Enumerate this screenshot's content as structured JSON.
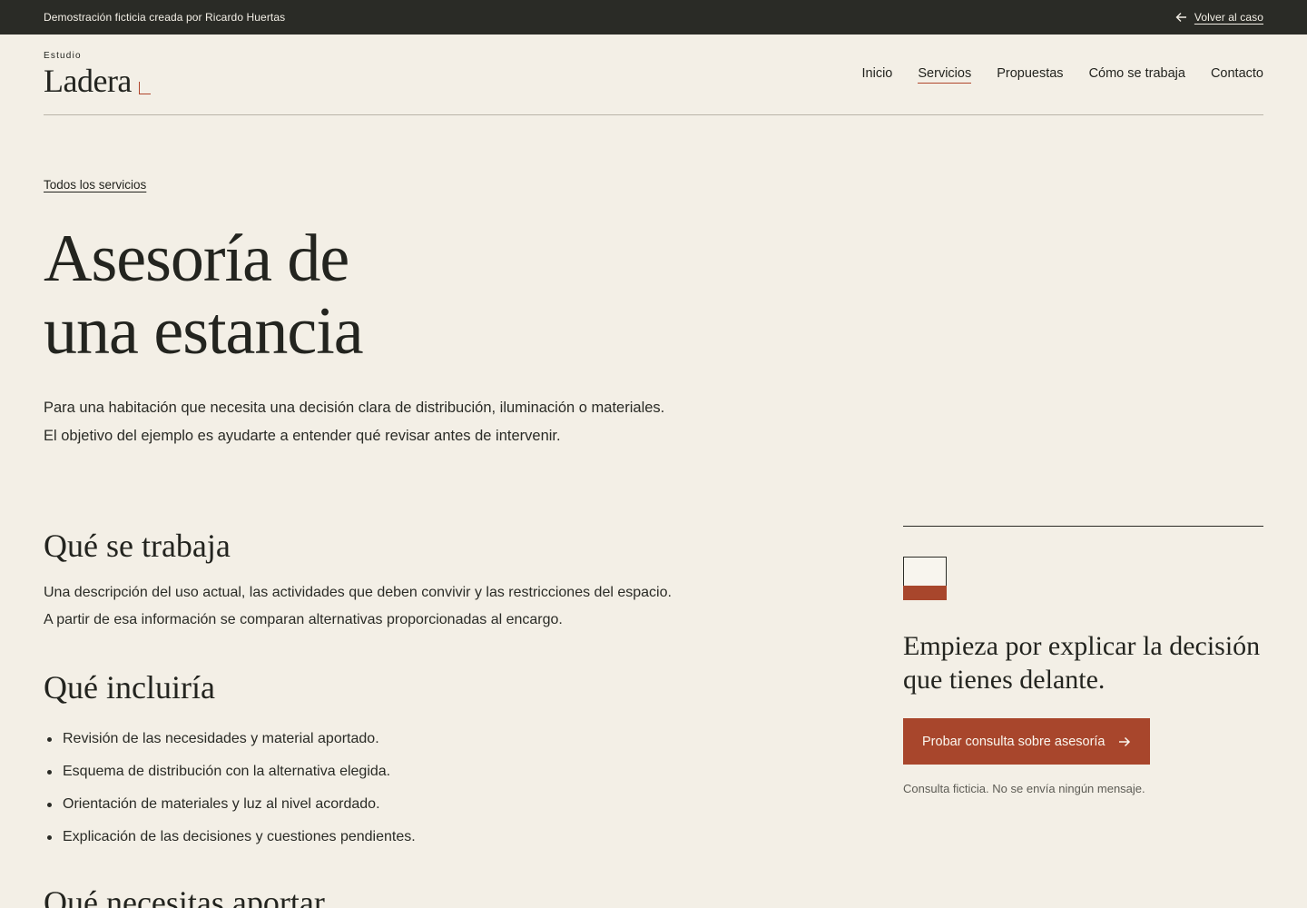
{
  "demo_bar": {
    "notice": "Demostración ficticia creada por Ricardo Huertas",
    "back_label": "Volver al caso",
    "back_icon": "arrow-left-icon"
  },
  "header": {
    "logo_small": "Estudio",
    "logo_big": "Ladera",
    "nav": [
      {
        "label": "Inicio"
      },
      {
        "label": "Servicios",
        "active": true
      },
      {
        "label": "Propuestas"
      },
      {
        "label": "Cómo se trabaja"
      },
      {
        "label": "Contacto"
      }
    ]
  },
  "main": {
    "breadcrumb": "Todos los servicios",
    "title_line1": "Asesoría de",
    "title_line2": "una estancia",
    "intro": "Para una habitación que necesita una decisión clara de distribución, iluminación o materiales. El objetivo del ejemplo es ayudarte a entender qué revisar antes de intervenir.",
    "section1_title": "Qué se trabaja",
    "section1_text": "Una descripción del uso actual, las actividades que deben convivir y las restricciones del espacio. A partir de esa información se comparan alternativas proporcionadas al encargo.",
    "section2_title": "Qué incluiría",
    "section2_items": [
      "Revisión de las necesidades y material aportado.",
      "Esquema de distribución con la alternativa elegida.",
      "Orientación de materiales y luz al nivel acordado.",
      "Explicación de las decisiones y cuestiones pendientes."
    ],
    "section3_title": "Qué necesitas aportar"
  },
  "cta": {
    "heading": "Empieza por explicar la decisión que tienes delante.",
    "button_label": "Probar consulta sobre asesoría",
    "button_icon": "arrow-right-icon",
    "note": "Consulta ficticia. No se envía ningún mensaje."
  },
  "colors": {
    "background": "#f3efe6",
    "dark": "#2a2b26",
    "accent": "#a8462c"
  }
}
